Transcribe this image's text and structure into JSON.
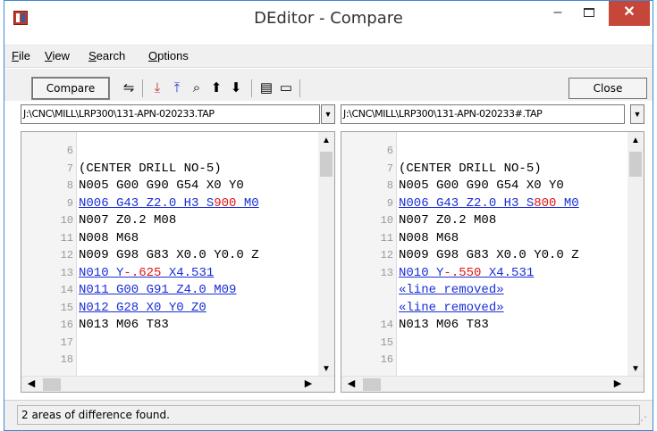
{
  "window": {
    "title": "DEditor - Compare",
    "minimize_glyph": "–",
    "close_glyph": "✕"
  },
  "menu": [
    {
      "accel": "F",
      "rest": "ile"
    },
    {
      "accel": "V",
      "rest": "iew"
    },
    {
      "accel": "S",
      "rest": "earch"
    },
    {
      "accel": "O",
      "rest": "ptions"
    }
  ],
  "toolbar": {
    "compare_label": "Compare",
    "close_label": "Close",
    "icons": [
      "swap-icon",
      "move-to-bottom-icon",
      "move-to-top-icon",
      "find-icon",
      "previous-difference-icon",
      "next-difference-icon",
      "open-file-icon",
      "new-document-icon"
    ]
  },
  "left": {
    "path": "J:\\CNC\\MILL\\LRP300\\131-APN-020233.TAP",
    "lines": [
      {
        "n": "6",
        "text": ""
      },
      {
        "n": "7",
        "text": "(CENTER DRILL NO-5)"
      },
      {
        "n": "8",
        "text": "N005 G00 G90 G54 X0 Y0"
      },
      {
        "n": "9",
        "pre": "N006 G43 Z2.0 H3 S",
        "hl": "900",
        "post": " M0",
        "diff": true
      },
      {
        "n": "10",
        "text": "N007 Z0.2 M08"
      },
      {
        "n": "11",
        "text": "N008 M68"
      },
      {
        "n": "12",
        "text": "N009 G98 G83 X0.0 Y0.0 Z"
      },
      {
        "n": "13",
        "pre": "N010 Y",
        "hl": "-.625",
        "post": " X4.531",
        "diff": true
      },
      {
        "n": "14",
        "text": "N011 G00 G91 Z4.0 M09",
        "removed": true
      },
      {
        "n": "15",
        "text": "N012 G28 X0 Y0 Z0",
        "removed": true
      },
      {
        "n": "16",
        "text": "N013 M06 T83"
      },
      {
        "n": "17",
        "text": ""
      },
      {
        "n": "18",
        "text": ""
      }
    ]
  },
  "right": {
    "path": "J:\\CNC\\MILL\\LRP300\\131-APN-020233#.TAP",
    "lines": [
      {
        "n": "6",
        "text": ""
      },
      {
        "n": "7",
        "text": "(CENTER DRILL NO-5)"
      },
      {
        "n": "8",
        "text": "N005 G00 G90 G54 X0 Y0"
      },
      {
        "n": "9",
        "pre": "N006 G43 Z2.0 H3 S",
        "hl": "800",
        "post": " M0",
        "diff": true
      },
      {
        "n": "10",
        "text": "N007 Z0.2 M08"
      },
      {
        "n": "11",
        "text": "N008 M68"
      },
      {
        "n": "12",
        "text": "N009 G98 G83 X0.0 Y0.0 Z"
      },
      {
        "n": "13",
        "pre": "N010 Y",
        "hl": "-.550",
        "post": " X4.531",
        "diff": true
      },
      {
        "n": "",
        "text": "«line removed»",
        "removed": true
      },
      {
        "n": "",
        "text": "«line removed»",
        "removed": true
      },
      {
        "n": "14",
        "text": "N013 M06 T83"
      },
      {
        "n": "15",
        "text": ""
      },
      {
        "n": "16",
        "text": ""
      }
    ]
  },
  "status": "2 areas of difference found."
}
